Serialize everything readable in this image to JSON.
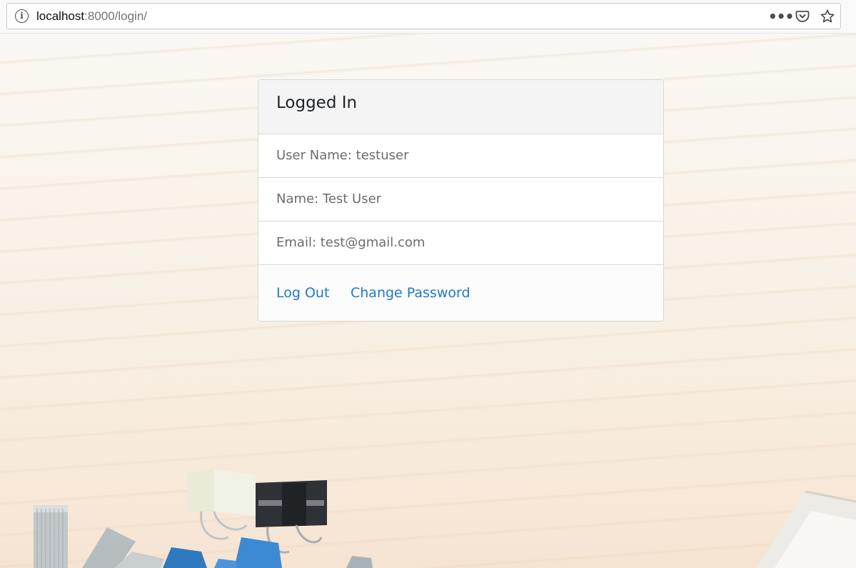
{
  "browser": {
    "url_host": "localhost",
    "url_path": ":8000/login/",
    "icons": [
      "info-icon",
      "more-options-icon",
      "pocket-icon",
      "bookmark-star-icon"
    ]
  },
  "card": {
    "title": "Logged In",
    "rows": [
      {
        "text": "User Name: testuser"
      },
      {
        "text": "Name: Test User"
      },
      {
        "text": "Email: test@gmail.com"
      }
    ],
    "links": {
      "logout": "Log Out",
      "change_password": "Change Password"
    }
  },
  "colors": {
    "link": "#1f77d0",
    "text_muted": "#6c6c6c",
    "title": "#212529",
    "card_header_bg": "#f4f4f4",
    "page_bg": "#faf5ee"
  }
}
